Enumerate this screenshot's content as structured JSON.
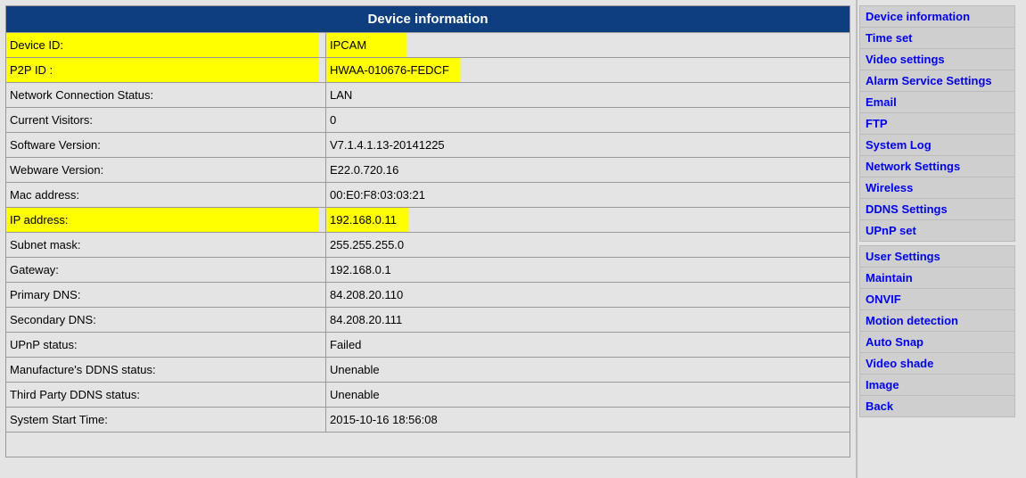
{
  "title": "Device information",
  "rows": [
    {
      "label": "Device ID:",
      "value": "IPCAM",
      "label_hl": 350,
      "value_hl": 90
    },
    {
      "label": "P2P ID :",
      "value": "HWAA-010676-FEDCF",
      "label_hl": 350,
      "value_hl": 150
    },
    {
      "label": "Network Connection Status:",
      "value": "LAN"
    },
    {
      "label": "Current Visitors:",
      "value": "0"
    },
    {
      "label": "Software Version:",
      "value": "V7.1.4.1.13-20141225"
    },
    {
      "label": "Webware Version:",
      "value": "E22.0.720.16"
    },
    {
      "label": "Mac address:",
      "value": "00:E0:F8:03:03:21"
    },
    {
      "label": "IP address:",
      "value": "192.168.0.11",
      "label_hl": 350,
      "value_hl": 92
    },
    {
      "label": "Subnet mask:",
      "value": "255.255.255.0"
    },
    {
      "label": "Gateway:",
      "value": "192.168.0.1"
    },
    {
      "label": "Primary DNS:",
      "value": "84.208.20.110"
    },
    {
      "label": "Secondary DNS:",
      "value": "84.208.20.111"
    },
    {
      "label": "UPnP status:",
      "value": "Failed"
    },
    {
      "label": "Manufacture's DDNS status:",
      "value": "Unenable"
    },
    {
      "label": "Third Party DDNS status:",
      "value": "Unenable"
    },
    {
      "label": "System Start Time:",
      "value": "2015-10-16 18:56:08"
    }
  ],
  "sidebar": {
    "group1": [
      "Device information",
      "Time set",
      "Video settings",
      "Alarm Service Settings",
      "Email",
      "FTP",
      "System Log",
      "Network Settings",
      "Wireless",
      "DDNS Settings",
      "UPnP set"
    ],
    "group2": [
      "User Settings",
      "Maintain",
      "ONVIF",
      "Motion detection",
      "Auto Snap",
      "Video shade",
      "Image",
      "Back"
    ]
  }
}
